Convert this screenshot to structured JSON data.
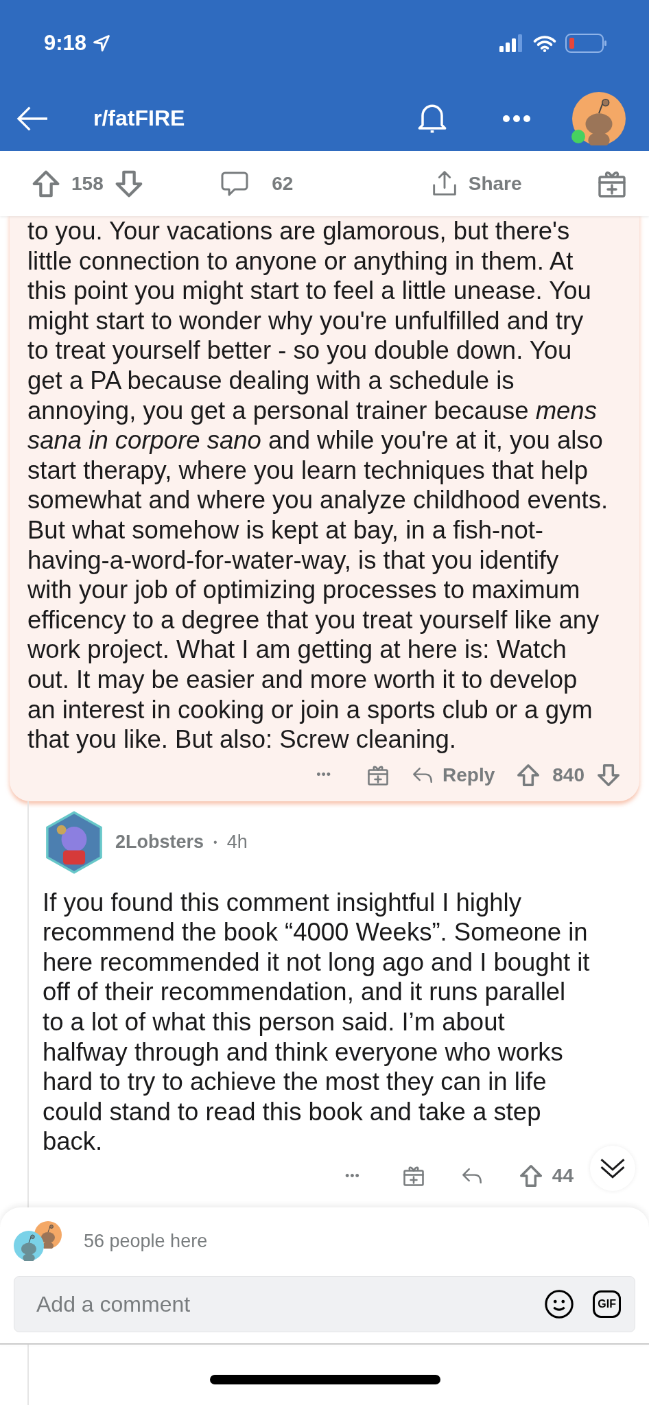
{
  "status_bar": {
    "time": "9:18"
  },
  "header": {
    "title": "r/fatFIRE"
  },
  "post_actions": {
    "upvotes": "158",
    "comments": "62",
    "share": "Share"
  },
  "comment": {
    "lines": [
      "to you. Your vacations are glamorous, but there's",
      "little connection to anyone or anything in them. At",
      "this point you might start to feel a little unease. You",
      "might start to wonder why you're unfulfilled and try",
      "to treat yourself better - so you double down. You",
      "get a PA because dealing with a schedule is",
      "annoying, you get a personal trainer because *mens*",
      "*sana in corpore sano* and while you're at it, you also",
      "start therapy, where you learn techniques that help",
      "somewhat and where you analyze childhood events.",
      "But what somehow is kept at bay, in a fish-not-",
      "having-a-word-for-water-way, is that you identify",
      "with your job of optimizing processes to maximum",
      "efficency to a degree that you treat yourself like any",
      "work project. What I am getting at here is: Watch",
      "out. It may be easier and more worth it to develop",
      "an interest in cooking or join a sports club or a gym",
      "that you like. But also: Screw cleaning."
    ],
    "more": "•••",
    "reply": "Reply",
    "score": "840"
  },
  "reply": {
    "author": "2Lobsters",
    "separator": "•",
    "age": "4h",
    "lines": [
      "If you found this comment insightful I highly",
      "recommend the book “4000 Weeks”. Someone in",
      "here recommended it not long ago and I bought it",
      "off of their recommendation, and it runs parallel",
      "to a lot of what this person said. I’m about",
      "halfway through and think everyone who works",
      "hard to try to achieve the most they can in life",
      "could stand to read this book and take a step",
      "back."
    ],
    "more": "•••",
    "score": "44"
  },
  "composer": {
    "presence": "56 people here",
    "placeholder": "Add a comment",
    "gif": "GIF"
  }
}
